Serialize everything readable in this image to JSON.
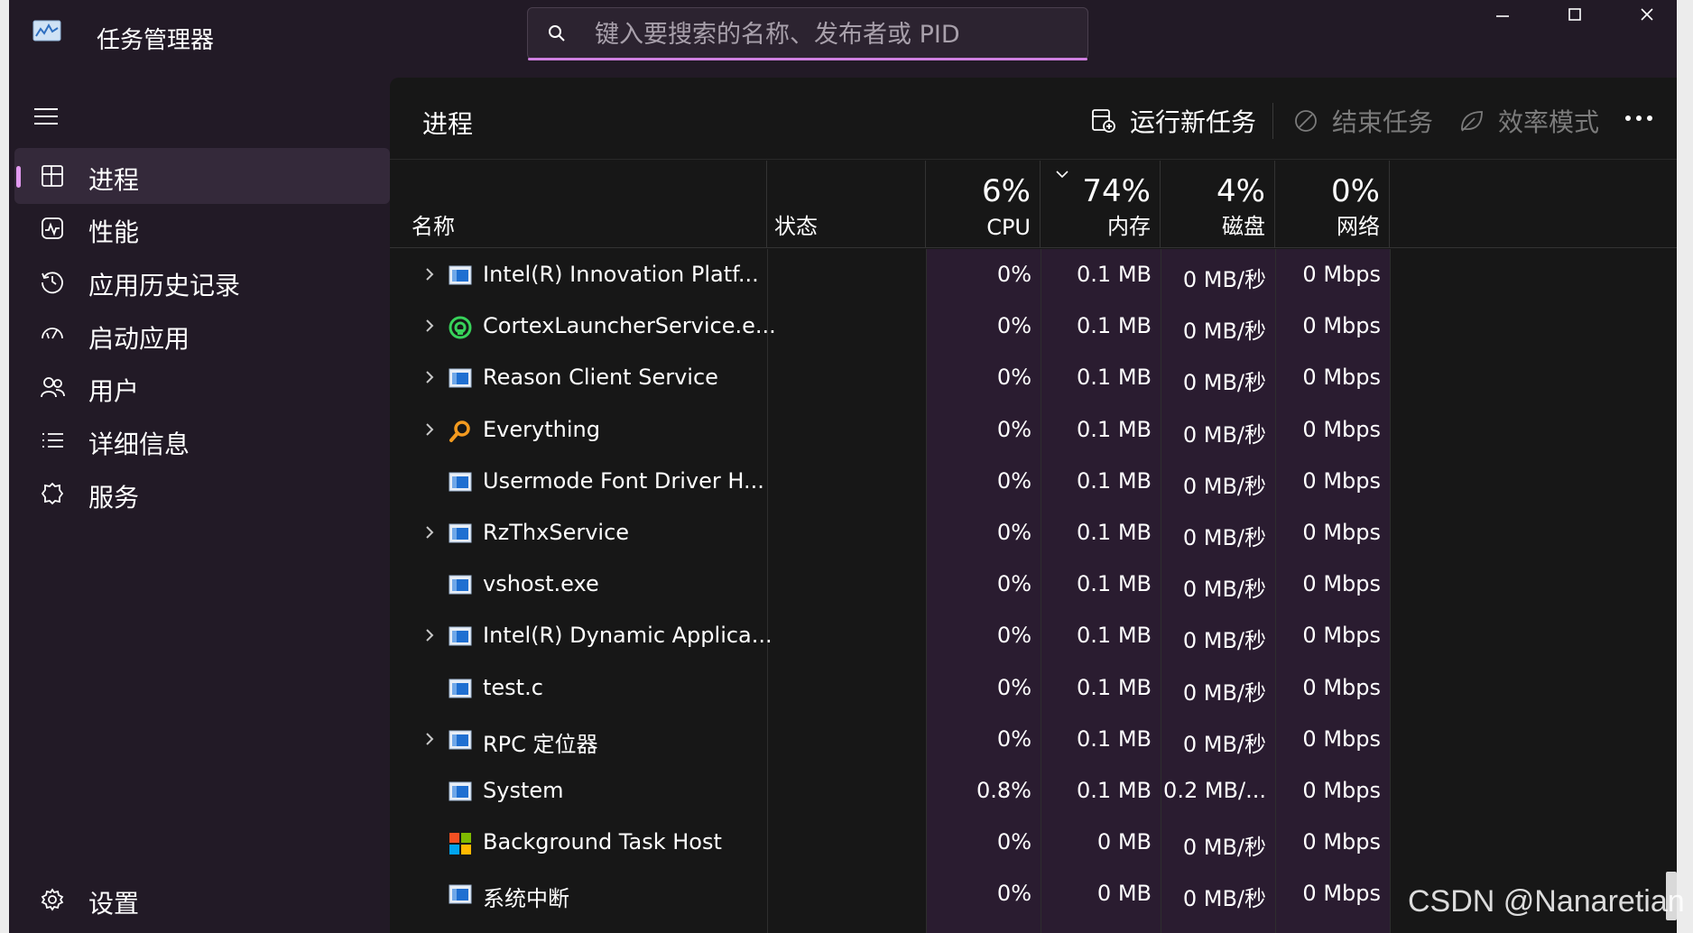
{
  "app": {
    "title": "任务管理器"
  },
  "search": {
    "placeholder": "键入要搜索的名称、发布者或 PID"
  },
  "window_controls": [
    "minimize",
    "maximize",
    "close"
  ],
  "sidebar": {
    "items": [
      {
        "label": "进程",
        "icon": "processes-icon",
        "active": true
      },
      {
        "label": "性能",
        "icon": "performance-icon",
        "active": false
      },
      {
        "label": "应用历史记录",
        "icon": "app-history-icon",
        "active": false
      },
      {
        "label": "启动应用",
        "icon": "startup-icon",
        "active": false
      },
      {
        "label": "用户",
        "icon": "users-icon",
        "active": false
      },
      {
        "label": "详细信息",
        "icon": "details-icon",
        "active": false
      },
      {
        "label": "服务",
        "icon": "services-icon",
        "active": false
      }
    ],
    "settings_label": "设置"
  },
  "toolbar": {
    "page_title": "进程",
    "run_new_task": "运行新任务",
    "end_task": "结束任务",
    "efficiency_mode": "效率模式"
  },
  "columns": {
    "name": "名称",
    "status": "状态",
    "cpu": {
      "pct": "6%",
      "label": "CPU"
    },
    "memory": {
      "pct": "74%",
      "label": "内存"
    },
    "disk": {
      "pct": "4%",
      "label": "磁盘"
    },
    "network": {
      "pct": "0%",
      "label": "网络"
    }
  },
  "processes": [
    {
      "name": "Intel(R) Innovation Platf...",
      "expandable": true,
      "icon": "service-icon",
      "cpu": "0%",
      "mem": "0.1 MB",
      "disk": "0 MB/秒",
      "net": "0 Mbps"
    },
    {
      "name": "CortexLauncherService.e...",
      "expandable": true,
      "icon": "cortex-icon",
      "cpu": "0%",
      "mem": "0.1 MB",
      "disk": "0 MB/秒",
      "net": "0 Mbps"
    },
    {
      "name": "Reason Client Service",
      "expandable": true,
      "icon": "service-icon",
      "cpu": "0%",
      "mem": "0.1 MB",
      "disk": "0 MB/秒",
      "net": "0 Mbps"
    },
    {
      "name": "Everything",
      "expandable": true,
      "icon": "magnifier-icon",
      "cpu": "0%",
      "mem": "0.1 MB",
      "disk": "0 MB/秒",
      "net": "0 Mbps"
    },
    {
      "name": "Usermode Font Driver H...",
      "expandable": false,
      "icon": "service-icon",
      "cpu": "0%",
      "mem": "0.1 MB",
      "disk": "0 MB/秒",
      "net": "0 Mbps"
    },
    {
      "name": "RzThxService",
      "expandable": true,
      "icon": "service-icon",
      "cpu": "0%",
      "mem": "0.1 MB",
      "disk": "0 MB/秒",
      "net": "0 Mbps"
    },
    {
      "name": "vshost.exe",
      "expandable": false,
      "icon": "service-icon",
      "cpu": "0%",
      "mem": "0.1 MB",
      "disk": "0 MB/秒",
      "net": "0 Mbps"
    },
    {
      "name": "Intel(R) Dynamic Applica...",
      "expandable": true,
      "icon": "service-icon",
      "cpu": "0%",
      "mem": "0.1 MB",
      "disk": "0 MB/秒",
      "net": "0 Mbps"
    },
    {
      "name": "test.c",
      "expandable": false,
      "icon": "service-icon",
      "cpu": "0%",
      "mem": "0.1 MB",
      "disk": "0 MB/秒",
      "net": "0 Mbps"
    },
    {
      "name": "RPC 定位器",
      "expandable": true,
      "icon": "service-icon",
      "cpu": "0%",
      "mem": "0.1 MB",
      "disk": "0 MB/秒",
      "net": "0 Mbps"
    },
    {
      "name": "System",
      "expandable": false,
      "icon": "service-icon",
      "cpu": "0.8%",
      "mem": "0.1 MB",
      "disk": "0.2 MB/...",
      "net": "0 Mbps"
    },
    {
      "name": "Background Task Host",
      "expandable": false,
      "icon": "windows-logo-icon",
      "cpu": "0%",
      "mem": "0 MB",
      "disk": "0 MB/秒",
      "net": "0 Mbps"
    },
    {
      "name": "系统中断",
      "expandable": false,
      "icon": "service-icon",
      "cpu": "0%",
      "mem": "0 MB",
      "disk": "0 MB/秒",
      "net": "0 Mbps"
    }
  ],
  "watermark": "CSDN @Nanaretian",
  "colors": {
    "window_bg": "#221a26",
    "main_bg": "#171717",
    "accent": "#e29af0",
    "heat_column": "#2a1c30"
  }
}
